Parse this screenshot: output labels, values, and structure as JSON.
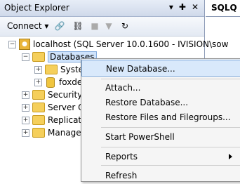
{
  "panel": {
    "title": "Object Explorer",
    "title_icons": [
      "▾",
      "✚",
      "✕"
    ],
    "connect_label": "Connect ▾"
  },
  "tab": {
    "label": "SQLQ"
  },
  "tree": {
    "server": "localhost (SQL Server 10.0.1600 - IVISION\\sow",
    "databases": "Databases",
    "system": "Syste",
    "foxde": "foxde",
    "security": "Security",
    "server_objects": "Server Ob",
    "replication": "Replicatio",
    "management": "Manager"
  },
  "context_menu": {
    "new_database": "New Database...",
    "attach": "Attach...",
    "restore_database": "Restore Database...",
    "restore_files": "Restore Files and Filegroups...",
    "start_powershell": "Start PowerShell",
    "reports": "Reports",
    "refresh": "Refresh"
  }
}
